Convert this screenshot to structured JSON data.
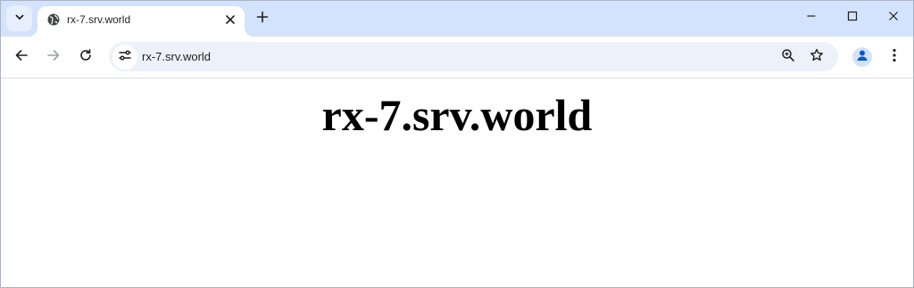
{
  "tab": {
    "title": "rx-7.srv.world",
    "favicon": "globe-icon"
  },
  "toolbar": {
    "url": "rx-7.srv.world",
    "site_info_icon": "tune-icon"
  },
  "page": {
    "heading": "rx-7.srv.world"
  },
  "colors": {
    "tabstrip_bg": "#d3e3fd",
    "omnibox_bg": "#edf2fa",
    "avatar_accent": "#0b57d0"
  }
}
